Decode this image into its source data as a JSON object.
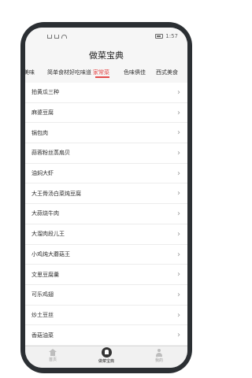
{
  "status_bar": {
    "time": "1:57"
  },
  "header": {
    "title": "做菜宝典"
  },
  "tabs": {
    "items": [
      {
        "label": "美味"
      },
      {
        "label": "简单食材好吃味道"
      },
      {
        "label": "家常菜"
      },
      {
        "label": "色味俱佳"
      },
      {
        "label": "西式美食"
      }
    ],
    "active": "家常菜"
  },
  "recipes": [
    {
      "name": "拍黄瓜三种"
    },
    {
      "name": "麻婆豆腐"
    },
    {
      "name": "锅包肉"
    },
    {
      "name": "蒜蓉粉丝蒸扇贝"
    },
    {
      "name": "油焖大虾"
    },
    {
      "name": "大王骨汤白菜炖豆腐"
    },
    {
      "name": "大蒜烧牛肉"
    },
    {
      "name": "大溜肉段儿王"
    },
    {
      "name": "小鸡炖大蘑菇王"
    },
    {
      "name": "文思豆腐羹"
    },
    {
      "name": "可乐鸡翅"
    },
    {
      "name": "炒土豆丝"
    },
    {
      "name": "香菇油菜"
    }
  ],
  "bottom_nav": {
    "items": [
      {
        "label": "首页"
      },
      {
        "label": "做菜宝典"
      },
      {
        "label": "我的"
      }
    ],
    "active": "做菜宝典"
  },
  "colors": {
    "accent": "#e44b4b",
    "phone_frame": "#2b2f33"
  }
}
